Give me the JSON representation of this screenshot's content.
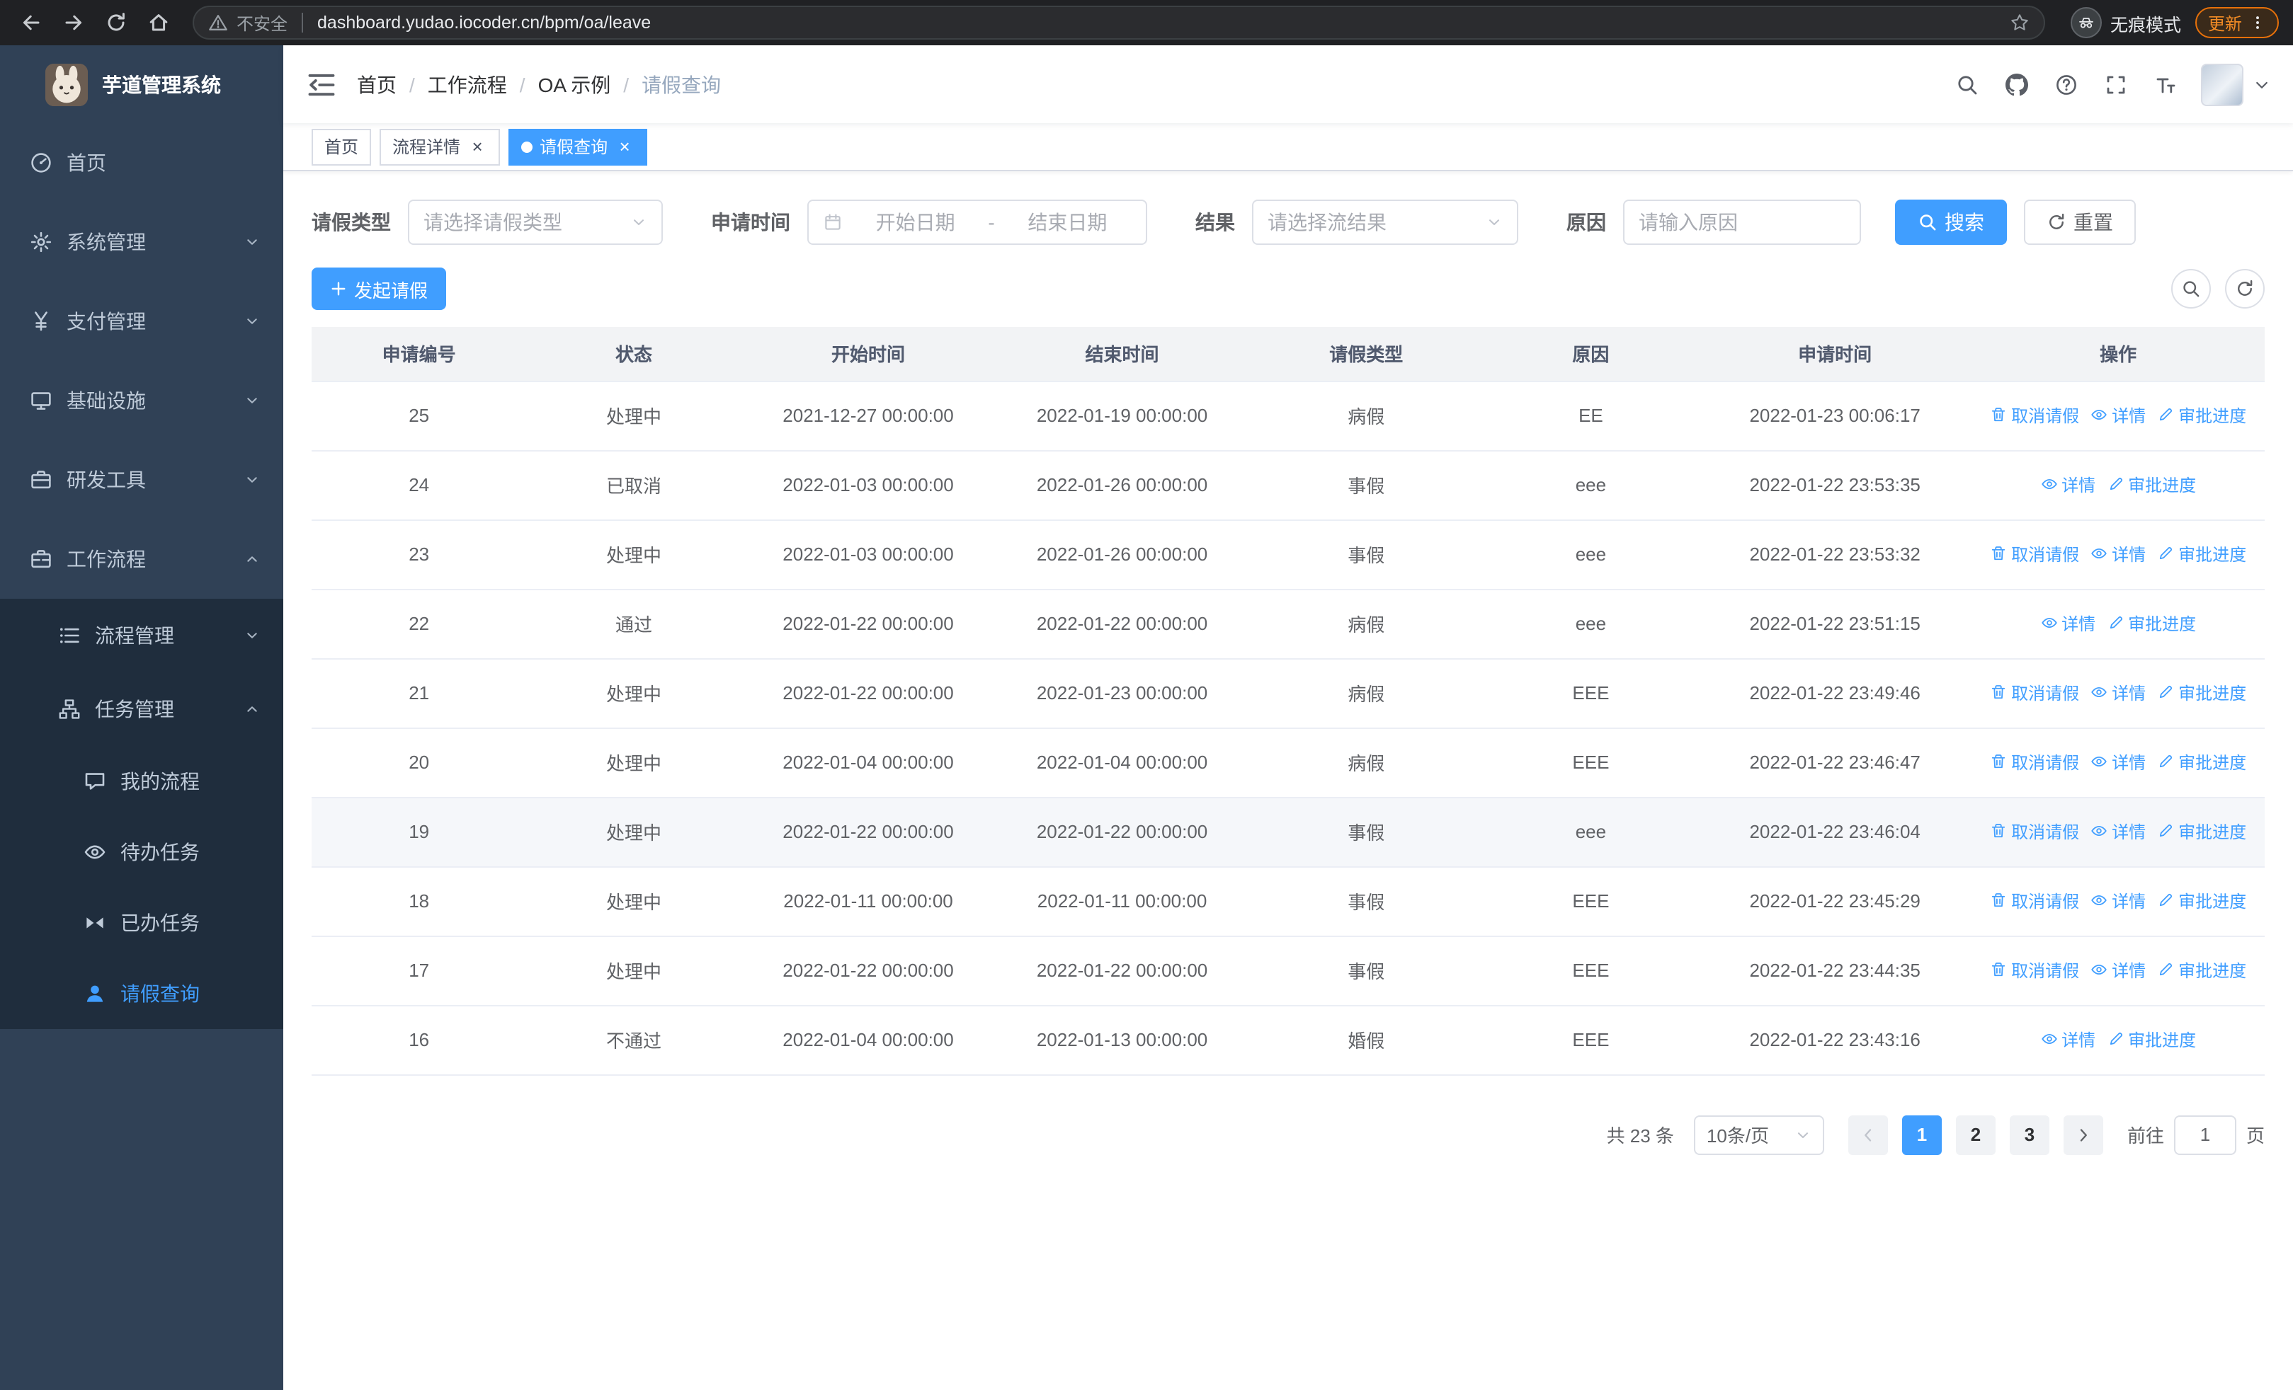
{
  "browser": {
    "security_label": "不安全",
    "url": "dashboard.yudao.iocoder.cn/bpm/oa/leave",
    "incognito_label": "无痕模式",
    "update_label": "更新"
  },
  "sidebar": {
    "logo_title": "芋道管理系统",
    "menu": {
      "home": "首页",
      "system": "系统管理",
      "payment": "支付管理",
      "infra": "基础设施",
      "devtools": "研发工具",
      "workflow": "工作流程",
      "process_mgmt": "流程管理",
      "task_mgmt": "任务管理",
      "my_process": "我的流程",
      "todo_task": "待办任务",
      "done_task": "已办任务",
      "leave_query": "请假查询"
    }
  },
  "navbar": {
    "breadcrumb": [
      "首页",
      "工作流程",
      "OA 示例",
      "请假查询"
    ]
  },
  "tabs": [
    {
      "label": "首页",
      "active": false,
      "closable": false
    },
    {
      "label": "流程详情",
      "active": false,
      "closable": true
    },
    {
      "label": "请假查询",
      "active": true,
      "closable": true
    }
  ],
  "filters": {
    "leave_type_label": "请假类型",
    "leave_type_placeholder": "请选择请假类型",
    "apply_time_label": "申请时间",
    "start_date_placeholder": "开始日期",
    "date_separator": "-",
    "end_date_placeholder": "结束日期",
    "result_label": "结果",
    "result_placeholder": "请选择流结果",
    "reason_label": "原因",
    "reason_placeholder": "请输入原因",
    "search_button": "搜索",
    "reset_button": "重置"
  },
  "toolbar": {
    "create_button": "发起请假"
  },
  "table": {
    "headers": [
      "申请编号",
      "状态",
      "开始时间",
      "结束时间",
      "请假类型",
      "原因",
      "申请时间",
      "操作"
    ],
    "action_labels": {
      "cancel": "取消请假",
      "detail": "详情",
      "progress": "审批进度"
    },
    "action_icons": {
      "cancel": "delete-icon",
      "detail": "eye-icon",
      "progress": "edit-icon"
    },
    "rows": [
      {
        "id": "25",
        "status": "处理中",
        "start": "2021-12-27 00:00:00",
        "end": "2022-01-19 00:00:00",
        "type": "病假",
        "reason": "EE",
        "apply_time": "2022-01-23 00:06:17",
        "actions": [
          "cancel",
          "detail",
          "progress"
        ],
        "highlight": false
      },
      {
        "id": "24",
        "status": "已取消",
        "start": "2022-01-03 00:00:00",
        "end": "2022-01-26 00:00:00",
        "type": "事假",
        "reason": "eee",
        "apply_time": "2022-01-22 23:53:35",
        "actions": [
          "detail",
          "progress"
        ],
        "highlight": false
      },
      {
        "id": "23",
        "status": "处理中",
        "start": "2022-01-03 00:00:00",
        "end": "2022-01-26 00:00:00",
        "type": "事假",
        "reason": "eee",
        "apply_time": "2022-01-22 23:53:32",
        "actions": [
          "cancel",
          "detail",
          "progress"
        ],
        "highlight": false
      },
      {
        "id": "22",
        "status": "通过",
        "start": "2022-01-22 00:00:00",
        "end": "2022-01-22 00:00:00",
        "type": "病假",
        "reason": "eee",
        "apply_time": "2022-01-22 23:51:15",
        "actions": [
          "detail",
          "progress"
        ],
        "highlight": false
      },
      {
        "id": "21",
        "status": "处理中",
        "start": "2022-01-22 00:00:00",
        "end": "2022-01-23 00:00:00",
        "type": "病假",
        "reason": "EEE",
        "apply_time": "2022-01-22 23:49:46",
        "actions": [
          "cancel",
          "detail",
          "progress"
        ],
        "highlight": false
      },
      {
        "id": "20",
        "status": "处理中",
        "start": "2022-01-04 00:00:00",
        "end": "2022-01-04 00:00:00",
        "type": "病假",
        "reason": "EEE",
        "apply_time": "2022-01-22 23:46:47",
        "actions": [
          "cancel",
          "detail",
          "progress"
        ],
        "highlight": false
      },
      {
        "id": "19",
        "status": "处理中",
        "start": "2022-01-22 00:00:00",
        "end": "2022-01-22 00:00:00",
        "type": "事假",
        "reason": "eee",
        "apply_time": "2022-01-22 23:46:04",
        "actions": [
          "cancel",
          "detail",
          "progress"
        ],
        "highlight": true
      },
      {
        "id": "18",
        "status": "处理中",
        "start": "2022-01-11 00:00:00",
        "end": "2022-01-11 00:00:00",
        "type": "事假",
        "reason": "EEE",
        "apply_time": "2022-01-22 23:45:29",
        "actions": [
          "cancel",
          "detail",
          "progress"
        ],
        "highlight": false
      },
      {
        "id": "17",
        "status": "处理中",
        "start": "2022-01-22 00:00:00",
        "end": "2022-01-22 00:00:00",
        "type": "事假",
        "reason": "EEE",
        "apply_time": "2022-01-22 23:44:35",
        "actions": [
          "cancel",
          "detail",
          "progress"
        ],
        "highlight": false
      },
      {
        "id": "16",
        "status": "不通过",
        "start": "2022-01-04 00:00:00",
        "end": "2022-01-13 00:00:00",
        "type": "婚假",
        "reason": "EEE",
        "apply_time": "2022-01-22 23:43:16",
        "actions": [
          "detail",
          "progress"
        ],
        "highlight": false
      }
    ]
  },
  "pagination": {
    "total_text": "共 23 条",
    "page_size_text": "10条/页",
    "pages": [
      "1",
      "2",
      "3"
    ],
    "current_page": "1",
    "goto_prefix": "前往",
    "goto_value": "1",
    "goto_suffix": "页"
  },
  "colors": {
    "primary": "#409eff",
    "sidebar_bg": "#304156",
    "sidebar_submenu_bg": "#1f2d3d",
    "sidebar_text": "#bfcbd9",
    "sidebar_active_text": "#409eff"
  }
}
